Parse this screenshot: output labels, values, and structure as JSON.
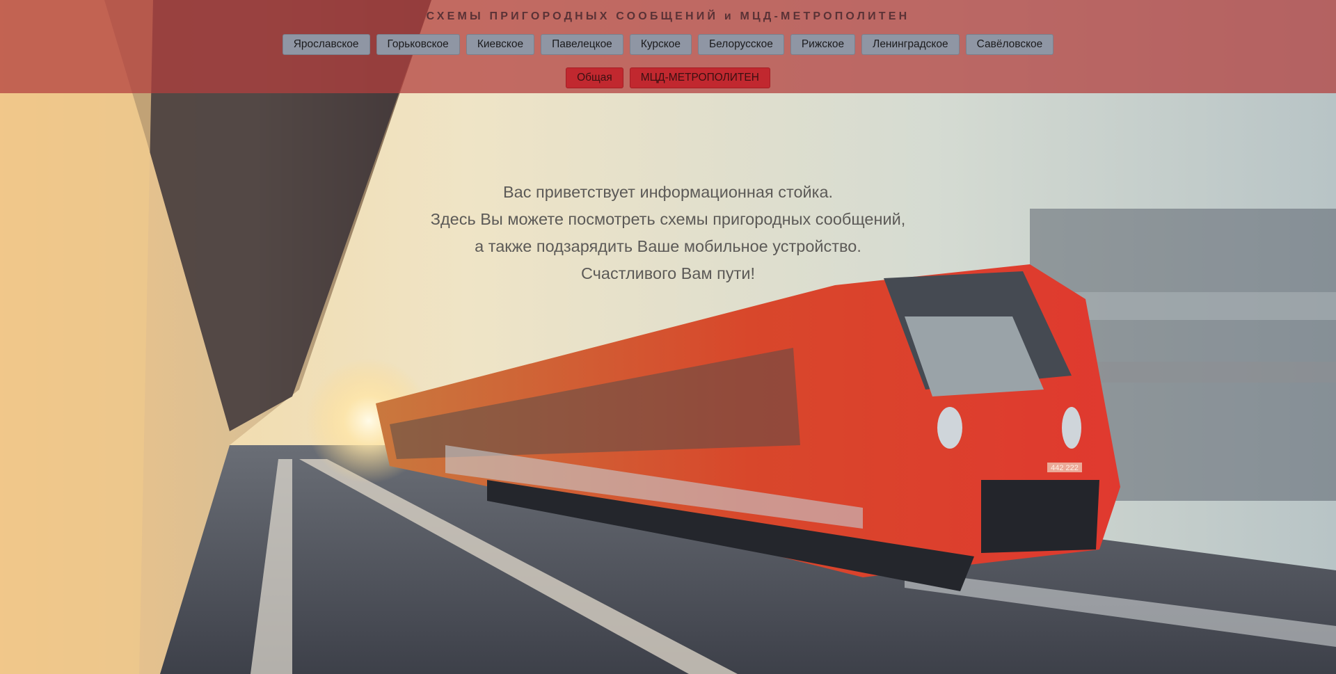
{
  "header": {
    "title": "СХЕМЫ ПРИГОРОДНЫХ СООБЩЕНИЙ и МЦД-МЕТРОПОЛИТЕН"
  },
  "nav": {
    "stations": [
      {
        "label": "Ярославское"
      },
      {
        "label": "Горьковское"
      },
      {
        "label": "Киевское"
      },
      {
        "label": "Павелецкое"
      },
      {
        "label": "Курское"
      },
      {
        "label": "Белорусское"
      },
      {
        "label": "Рижское"
      },
      {
        "label": "Ленинградское"
      },
      {
        "label": "Савёловское"
      }
    ],
    "secondary": [
      {
        "label": "Общая"
      },
      {
        "label": "МЦД-МЕТРОПОЛИТЕН"
      }
    ]
  },
  "welcome": {
    "lines": [
      "Вас приветствует информационная стойка.",
      "Здесь Вы можете посмотреть схемы пригородных сообщений,",
      "а также подзарядить Ваше мобильное устройство.",
      "Счастливого Вам пути!"
    ]
  },
  "train": {
    "number": "442 222"
  },
  "colors": {
    "header_overlay": "#b2403e",
    "nav_button": "#8f96a4",
    "accent_button": "#c1282f"
  }
}
